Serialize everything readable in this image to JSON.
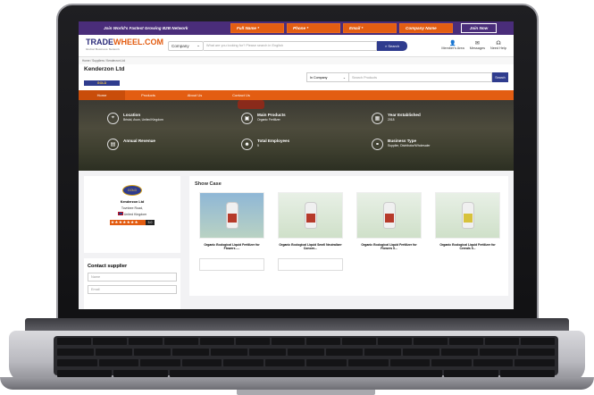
{
  "topbar": {
    "promo": "Join World's Fastest Growing B2B Network",
    "full_name": "Full Name *",
    "phone": "Phone *",
    "email": "Email *",
    "company_name": "Company Name",
    "join": "Join Now"
  },
  "header": {
    "logo_trade": "TRADE",
    "logo_wheel": "WHEEL.COM",
    "logo_tagline": "Global Business Network",
    "company_select": "Company",
    "search_placeholder": "What are you looking for? Please search in English",
    "search_button": "Search",
    "members_area": "Member's Area",
    "messages": "Messages",
    "need_help": "Need Help"
  },
  "breadcrumb": "Home / Suppliers / Kenderzon Ltd",
  "company": {
    "name": "Kenderzon Ltd",
    "tier": "GOLD",
    "scope_select": "In Company",
    "search_placeholder": "Search Products",
    "search_button": "Search"
  },
  "nav": [
    "Home",
    "Products",
    "About Us",
    "Contact Us"
  ],
  "stats": {
    "location_title": "Location",
    "location_value": "Bristol, Avon, United Kingdom",
    "products_title": "Main Products",
    "products_value": "Organic Fertilizer",
    "year_title": "Year Established",
    "year_value": "2018",
    "revenue_title": "Annual Revenue",
    "employees_title": "Total Employees",
    "employees_value": "5",
    "type_title": "Business Type",
    "type_value": "Supplier, Distributor/Wholesaler"
  },
  "profile": {
    "badge": "GOLD",
    "name": "Kenderzon Ltd",
    "address": "Tovnbee Road,",
    "country": "United Kingdom",
    "stars": "★★★★★★★",
    "rating": "5.0"
  },
  "contact": {
    "title": "Contact supplier",
    "name_placeholder": "Name",
    "email_placeholder": "Email"
  },
  "showcase": {
    "title": "Show Case",
    "products": [
      "Organic Ecological Liquid Fertilizer for Flowers -...",
      "Organic Ecological Liquid Smell Neutralizer Concen...",
      "Organic Ecological Liquid Fertilizer for Flowers 5...",
      "Organic Ecological Liquid Fertilizer for Cereals 5..."
    ]
  },
  "colors": {
    "brand_purple": "#4a2d7a",
    "brand_orange": "#e35d12",
    "brand_navy": "#2f3c8e"
  }
}
